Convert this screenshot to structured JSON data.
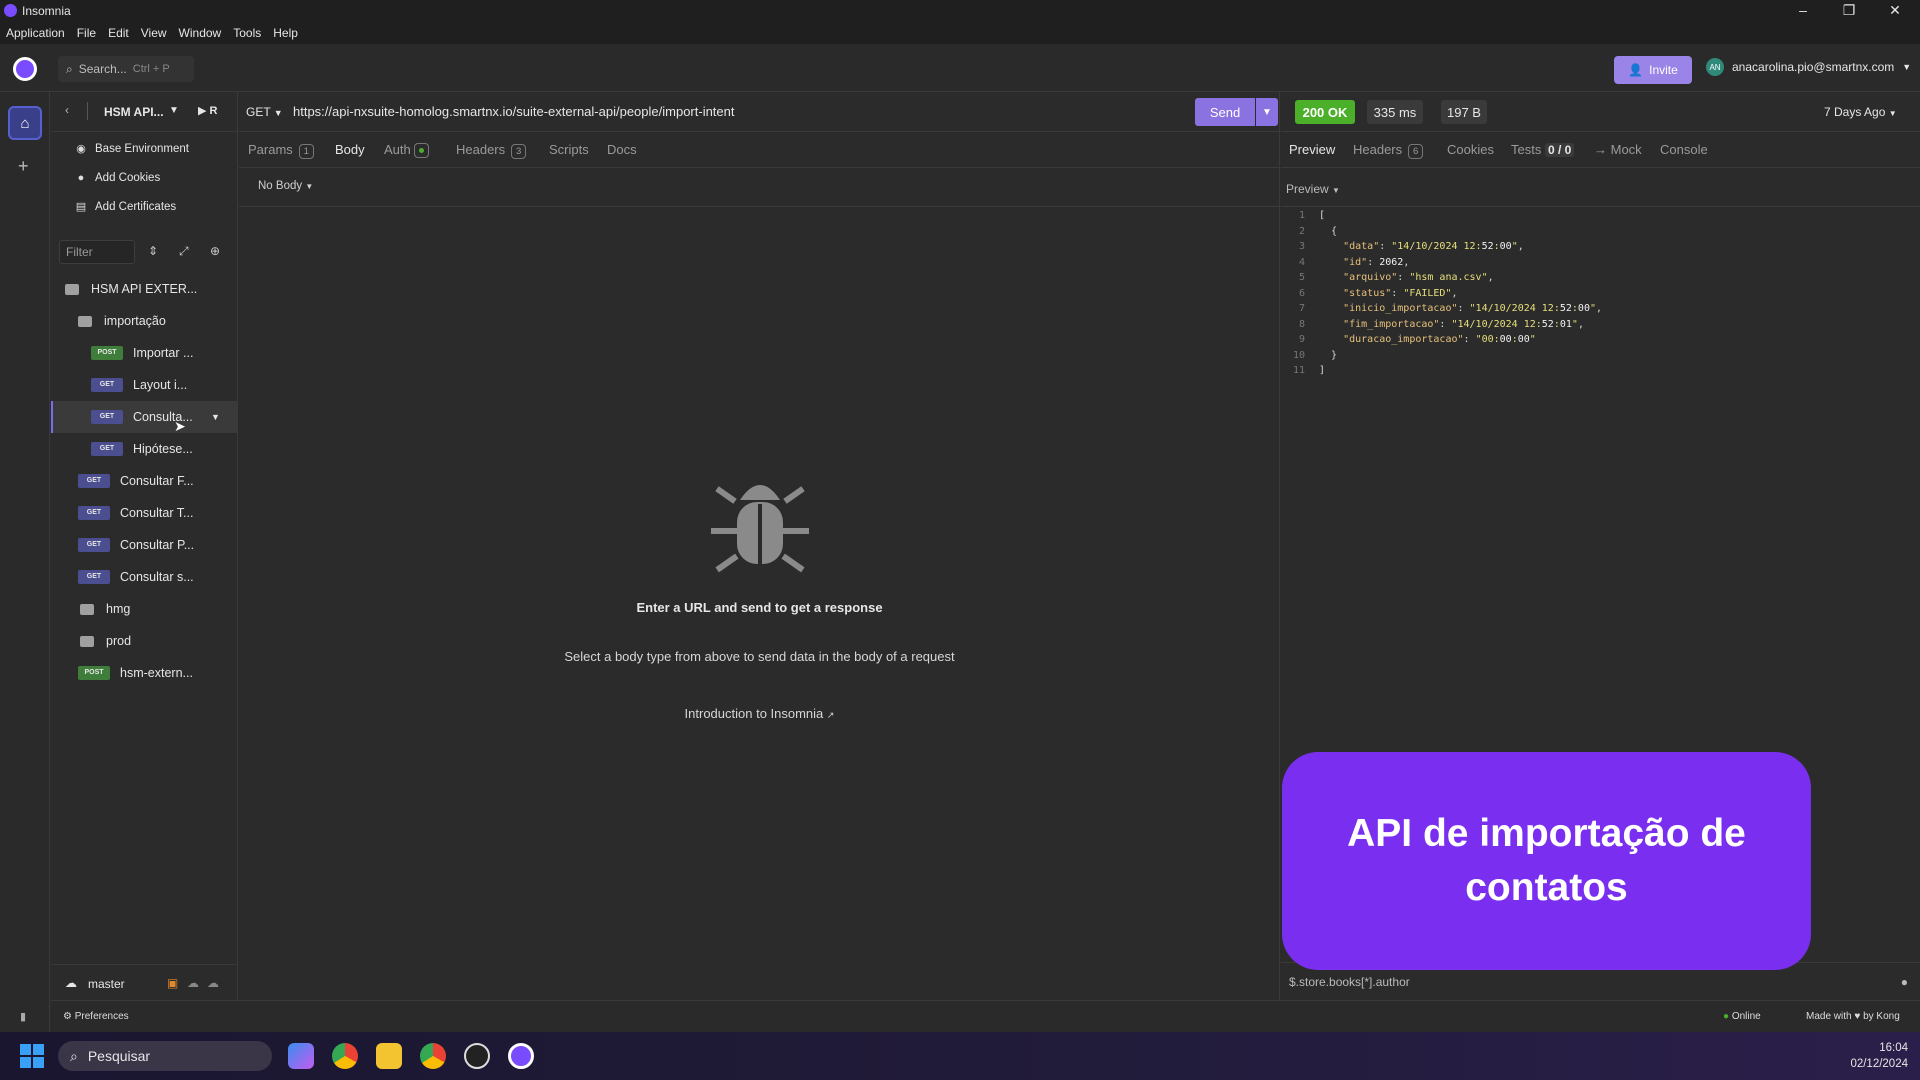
{
  "window": {
    "title": "Insomnia",
    "minimize": "–",
    "restore": "❐",
    "close": "✕"
  },
  "menu": [
    "Application",
    "File",
    "Edit",
    "View",
    "Window",
    "Tools",
    "Help"
  ],
  "topbar": {
    "search_label": "Search...",
    "search_shortcut": "Ctrl + P",
    "invite_label": "Invite",
    "user_initials": "AN",
    "user_email": "anacarolina.pio@smartnx.com"
  },
  "sidebar": {
    "project_name": "HSM API...",
    "run_label": "R",
    "menu": [
      {
        "label": "Base Environment",
        "icon": "globe-icon"
      },
      {
        "label": "Add Cookies",
        "icon": "cookie-icon"
      },
      {
        "label": "Add Certificates",
        "icon": "certificate-icon"
      }
    ],
    "filter_placeholder": "Filter",
    "tree": [
      {
        "type": "folder-open",
        "label": "HSM API EXTER...",
        "indent": 0
      },
      {
        "type": "folder-open",
        "label": "importação",
        "indent": 1
      },
      {
        "type": "request",
        "method": "POST",
        "label": "Importar ...",
        "indent": 2
      },
      {
        "type": "request",
        "method": "GET",
        "label": "Layout i...",
        "indent": 2
      },
      {
        "type": "request",
        "method": "GET",
        "label": "Consulta...",
        "indent": 2,
        "selected": true
      },
      {
        "type": "request",
        "method": "GET",
        "label": "Hipótese...",
        "indent": 2
      },
      {
        "type": "request",
        "method": "GET",
        "label": "Consultar F...",
        "indent": 1
      },
      {
        "type": "request",
        "method": "GET",
        "label": "Consultar T...",
        "indent": 1
      },
      {
        "type": "request",
        "method": "GET",
        "label": "Consultar P...",
        "indent": 1
      },
      {
        "type": "request",
        "method": "GET",
        "label": "Consultar s...",
        "indent": 1
      },
      {
        "type": "folder",
        "label": "hmg",
        "indent": 1
      },
      {
        "type": "folder",
        "label": "prod",
        "indent": 1
      },
      {
        "type": "request",
        "method": "POST",
        "label": "hsm-extern...",
        "indent": 1
      }
    ],
    "branch": "master"
  },
  "request": {
    "method": "GET",
    "url": "https://api-nxsuite-homolog.smartnx.io/suite-external-api/people/import-intent",
    "send_label": "Send",
    "tabs": [
      {
        "label": "Params",
        "count": "1"
      },
      {
        "label": "Body",
        "active": true
      },
      {
        "label": "Auth"
      },
      {
        "label": "Headers",
        "count": "3"
      },
      {
        "label": "Scripts"
      },
      {
        "label": "Docs"
      }
    ],
    "body_type": "No Body",
    "empty_title": "Enter a URL and send to get a response",
    "empty_sub": "Select a body type from above to send data in the body of a request",
    "intro_link": "Introduction to Insomnia"
  },
  "response": {
    "status": "200 OK",
    "time": "335 ms",
    "size": "197 B",
    "when": "7 Days Ago",
    "tabs": [
      {
        "label": "Preview",
        "active": true
      },
      {
        "label": "Headers",
        "count": "6"
      },
      {
        "label": "Cookies"
      },
      {
        "label": "Tests",
        "count": "0 / 0"
      },
      {
        "label": "→ Mock"
      },
      {
        "label": "Console"
      }
    ],
    "preview_mode": "Preview",
    "json_lines": [
      "[",
      "  {",
      "    \"data\": \"14/10/2024 12:52:00\",",
      "    \"id\": 2062,",
      "    \"arquivo\": \"hsm ana.csv\",",
      "    \"status\": \"FAILED\",",
      "    \"inicio_importacao\": \"14/10/2024 12:52:00\",",
      "    \"fim_importacao\": \"14/10/2024 12:52:01\",",
      "    \"duracao_importacao\": \"00:00:00\"",
      "  }",
      "]"
    ],
    "jsonpath_placeholder": "$.store.books[*].author"
  },
  "banner": {
    "text": "API de importação de contatos"
  },
  "statusbar": {
    "preferences": "Preferences",
    "online": "Online",
    "made_with": "Made with ♥ by Kong"
  },
  "taskbar": {
    "search": "Pesquisar",
    "time": "16:04",
    "date": "02/12/2024"
  },
  "colors": {
    "accent": "#8a72e0",
    "ok": "#4caf2a",
    "banner": "#7a2ff0"
  }
}
